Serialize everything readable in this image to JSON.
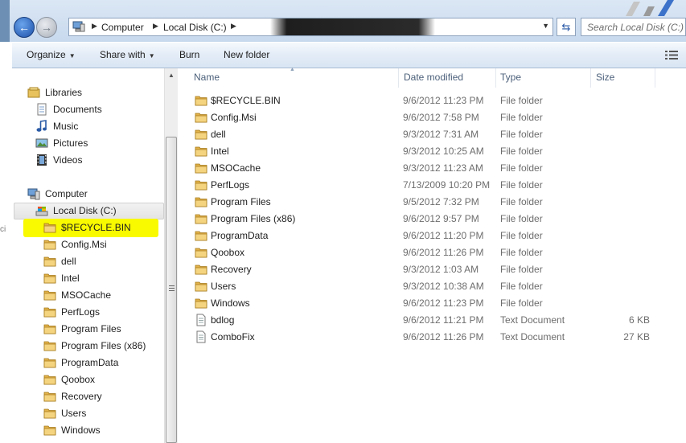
{
  "address": {
    "crumbs": [
      "Computer",
      "Local Disk (C:)"
    ],
    "search_placeholder": "Search Local Disk (C:)"
  },
  "toolbar": {
    "organize": "Organize",
    "share_with": "Share with",
    "burn": "Burn",
    "new_folder": "New folder"
  },
  "nav": {
    "libraries": "Libraries",
    "documents": "Documents",
    "music": "Music",
    "pictures": "Pictures",
    "videos": "Videos",
    "computer": "Computer",
    "local_disk": "Local Disk (C:)",
    "folders": [
      "$RECYCLE.BIN",
      "Config.Msi",
      "dell",
      "Intel",
      "MSOCache",
      "PerfLogs",
      "Program Files",
      "Program Files (x86)",
      "ProgramData",
      "Qoobox",
      "Recovery",
      "Users",
      "Windows"
    ],
    "highlight_color": "#f9f900"
  },
  "columns": {
    "name": "Name",
    "date": "Date modified",
    "type": "Type",
    "size": "Size"
  },
  "files": [
    {
      "name": "$RECYCLE.BIN",
      "date": "9/6/2012 11:23 PM",
      "type": "File folder",
      "size": "",
      "icon": "folder-icon"
    },
    {
      "name": "Config.Msi",
      "date": "9/6/2012 7:58 PM",
      "type": "File folder",
      "size": "",
      "icon": "folder-icon"
    },
    {
      "name": "dell",
      "date": "9/3/2012 7:31 AM",
      "type": "File folder",
      "size": "",
      "icon": "folder-icon"
    },
    {
      "name": "Intel",
      "date": "9/3/2012 10:25 AM",
      "type": "File folder",
      "size": "",
      "icon": "folder-icon"
    },
    {
      "name": "MSOCache",
      "date": "9/3/2012 11:23 AM",
      "type": "File folder",
      "size": "",
      "icon": "folder-icon"
    },
    {
      "name": "PerfLogs",
      "date": "7/13/2009 10:20 PM",
      "type": "File folder",
      "size": "",
      "icon": "folder-icon"
    },
    {
      "name": "Program Files",
      "date": "9/5/2012 7:32 PM",
      "type": "File folder",
      "size": "",
      "icon": "folder-icon"
    },
    {
      "name": "Program Files (x86)",
      "date": "9/6/2012 9:57 PM",
      "type": "File folder",
      "size": "",
      "icon": "folder-icon"
    },
    {
      "name": "ProgramData",
      "date": "9/6/2012 11:20 PM",
      "type": "File folder",
      "size": "",
      "icon": "folder-icon"
    },
    {
      "name": "Qoobox",
      "date": "9/6/2012 11:26 PM",
      "type": "File folder",
      "size": "",
      "icon": "folder-icon"
    },
    {
      "name": "Recovery",
      "date": "9/3/2012 1:03 AM",
      "type": "File folder",
      "size": "",
      "icon": "folder-icon"
    },
    {
      "name": "Users",
      "date": "9/3/2012 10:38 AM",
      "type": "File folder",
      "size": "",
      "icon": "folder-icon"
    },
    {
      "name": "Windows",
      "date": "9/6/2012 11:23 PM",
      "type": "File folder",
      "size": "",
      "icon": "folder-icon"
    },
    {
      "name": "bdlog",
      "date": "9/6/2012 11:21 PM",
      "type": "Text Document",
      "size": "6 KB",
      "icon": "text-document-icon"
    },
    {
      "name": "ComboFix",
      "date": "9/6/2012 11:26 PM",
      "type": "Text Document",
      "size": "27 KB",
      "icon": "text-document-icon"
    }
  ]
}
